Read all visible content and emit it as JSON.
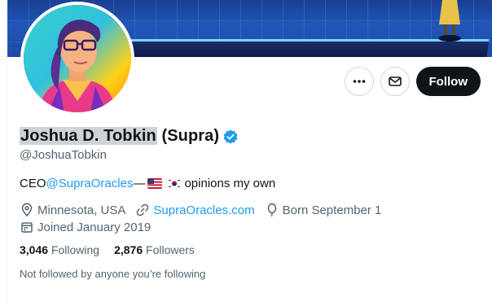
{
  "profile": {
    "name_highlighted": "Joshua D. Tobkin",
    "name_suffix": " (Supra)",
    "handle": "@JoshuaTobkin",
    "bio": {
      "prefix": "CEO ",
      "mention": "@SupraOracles",
      "dash": " — ",
      "suffix": " opinions my own"
    },
    "location": "Minnesota, USA",
    "website": "SupraOracles.com",
    "born": "Born September 1",
    "joined": "Joined January 2019",
    "following_count": "3,046",
    "following_label": "Following",
    "followers_count": "2,876",
    "followers_label": "Followers",
    "followed_by_note": "Not followed by anyone you’re following"
  },
  "actions": {
    "more_icon": "more-icon",
    "message_icon": "mail-icon",
    "follow_label": "Follow"
  },
  "colors": {
    "accent": "#1d9bf0",
    "text": "#0f1419",
    "secondary": "#536471",
    "follow_bg": "#0f1419"
  }
}
